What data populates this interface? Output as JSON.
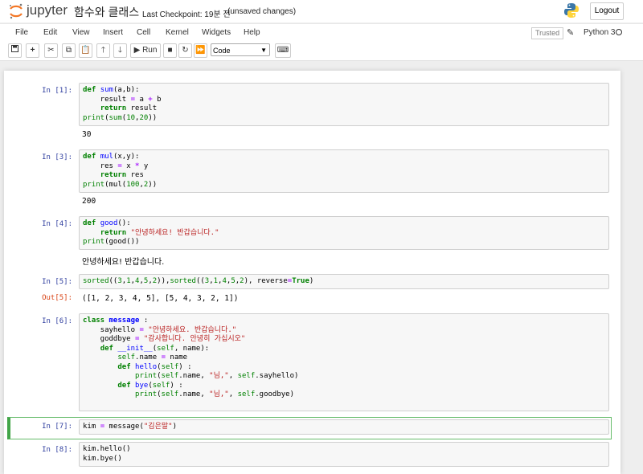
{
  "header": {
    "logo_text": "jupyter",
    "notebook_name": "함수와 클래스",
    "checkpoint": "Last Checkpoint: 19분 전",
    "save_status": "(unsaved changes)",
    "logout_label": "Logout"
  },
  "menu": {
    "items": [
      "File",
      "Edit",
      "View",
      "Insert",
      "Cell",
      "Kernel",
      "Widgets",
      "Help"
    ],
    "trusted_label": "Trusted",
    "kernel_name": "Python 3"
  },
  "toolbar": {
    "run_label": "Run",
    "cell_type": "Code",
    "icons": [
      "save-icon",
      "plus-icon",
      "cut-icon",
      "copy-icon",
      "paste-icon",
      "arrow-up-icon",
      "arrow-down-icon",
      "run-icon",
      "stop-icon",
      "restart-icon",
      "fast-forward-icon",
      "keyboard-icon"
    ]
  },
  "cells": [
    {
      "prompt": "In [1]:",
      "code": "def sum(a,b):\n    result = a + b\n    return result\nprint(sum(10,20))",
      "output": "30"
    },
    {
      "prompt": "In [3]:",
      "code": "def mul(x,y):\n    res = x * y\n    return res\nprint(mul(100,2))",
      "output": "200"
    },
    {
      "prompt": "In [4]:",
      "code": "def good():\n    return \"안녕하세요! 반갑습니다.\"\nprint(good())",
      "output": "안녕하세요! 반갑습니다."
    },
    {
      "prompt": "In [5]:",
      "code": "sorted((3,1,4,5,2)),sorted((3,1,4,5,2), reverse=True)",
      "out_prompt": "Out[5]:",
      "output": "([1, 2, 3, 4, 5], [5, 4, 3, 2, 1])"
    },
    {
      "prompt": "In [6]:",
      "code": "class message :\n    sayhello = \"안녕하세요. 반갑습니다.\"\n    goddbye = \"감사합니다. 안녕히 가십시오\"\n    def __init__(self, name):\n        self.name = name\n        def hello(self) :\n            print(self.name, \"님,\", self.sayhello)\n        def bye(self) :\n            print(self.name, \"님,\", self.goodbye)"
    },
    {
      "prompt": "In [7]:",
      "code": "kim = message(\"김은말\")"
    },
    {
      "prompt": "In [8]:",
      "code": "kim.hello()\nkim.bye()"
    }
  ],
  "colors": {
    "prompt_in": "#303f9f",
    "prompt_out": "#d84315",
    "selected_border": "#42a548",
    "keyword": "#008000",
    "string": "#ba2121"
  }
}
